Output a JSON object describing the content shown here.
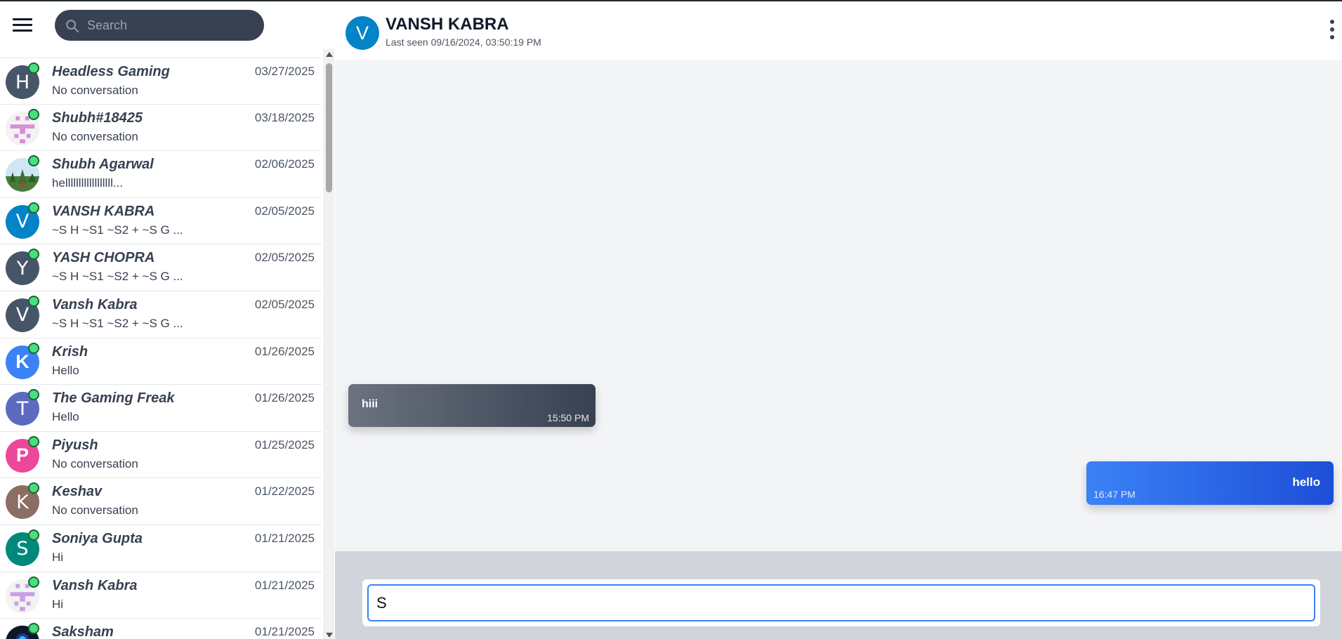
{
  "sidebar": {
    "search": {
      "placeholder": "Search"
    },
    "chats": [
      {
        "initial": "H",
        "name": "Headless Gaming",
        "preview": "No conversation",
        "date": "03/27/2025",
        "color": "#475569",
        "avatar_type": "letter"
      },
      {
        "initial": "",
        "name": "Shubh#18425",
        "preview": "No conversation",
        "date": "03/18/2025",
        "color": "#ffffff",
        "avatar_type": "identicon-pink"
      },
      {
        "initial": "",
        "name": "Shubh Agarwal",
        "preview": "hellllllllllllllllll...",
        "date": "02/06/2025",
        "color": "#ffffff",
        "avatar_type": "photo-landscape"
      },
      {
        "initial": "V",
        "name": "VANSH KABRA",
        "preview": "~S H ~S1 ~S2 + ~S G ...",
        "date": "02/05/2025",
        "color": "#0284c7",
        "avatar_type": "letter"
      },
      {
        "initial": "Y",
        "name": "YASH CHOPRA",
        "preview": "~S H ~S1 ~S2 + ~S G ...",
        "date": "02/05/2025",
        "color": "#475569",
        "avatar_type": "letter"
      },
      {
        "initial": "V",
        "name": "Vansh Kabra",
        "preview": "~S H ~S1 ~S2 + ~S G ...",
        "date": "02/05/2025",
        "color": "#475569",
        "avatar_type": "letter"
      },
      {
        "initial": "K",
        "name": "Krish",
        "preview": "Hello",
        "date": "01/26/2025",
        "color": "#3b82f6",
        "avatar_type": "letter-bold"
      },
      {
        "initial": "T",
        "name": "The Gaming Freak",
        "preview": "Hello",
        "date": "01/26/2025",
        "color": "#5c6bc0",
        "avatar_type": "letter"
      },
      {
        "initial": "P",
        "name": "Piyush",
        "preview": "No conversation",
        "date": "01/25/2025",
        "color": "#ec4899",
        "avatar_type": "letter-bold"
      },
      {
        "initial": "K",
        "name": "Keshav",
        "preview": "No conversation",
        "date": "01/22/2025",
        "color": "#8d6e63",
        "avatar_type": "letter"
      },
      {
        "initial": "S",
        "name": "Soniya Gupta",
        "preview": "Hi",
        "date": "01/21/2025",
        "color": "#00897b",
        "avatar_type": "letter"
      },
      {
        "initial": "",
        "name": "Vansh Kabra",
        "preview": "Hi",
        "date": "01/21/2025",
        "color": "#ffffff",
        "avatar_type": "identicon-purple"
      },
      {
        "initial": "",
        "name": "Saksham",
        "preview": "",
        "date": "01/21/2025",
        "color": "#111827",
        "avatar_type": "photo-dark"
      }
    ]
  },
  "chat": {
    "contact_initial": "V",
    "contact_name": "VANSH KABRA",
    "last_seen": "Last seen 09/16/2024, 03:50:19 PM",
    "messages": [
      {
        "direction": "incoming",
        "text": "hiii",
        "time": "15:50 PM"
      },
      {
        "direction": "outgoing",
        "text": "hello",
        "time": "16:47 PM"
      }
    ],
    "composer_value": "S"
  },
  "colors": {
    "search_bg": "#374151",
    "online": "#4ade80",
    "outgoing_bubble": "#2563eb",
    "incoming_bubble": "#4b5563",
    "accent": "#3b82f6"
  }
}
